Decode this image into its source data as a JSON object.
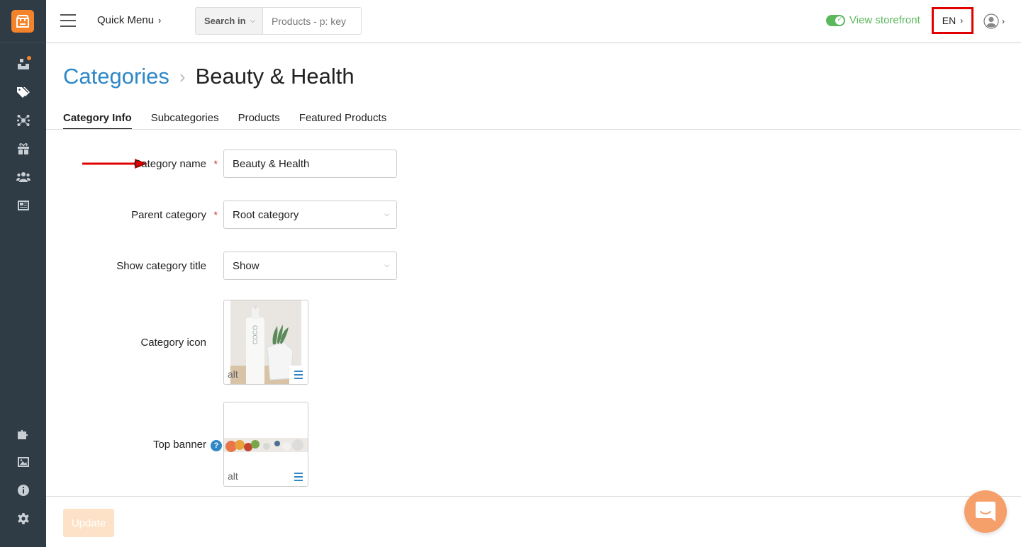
{
  "sidebar": {
    "items": [
      {
        "name": "orders-icon"
      },
      {
        "name": "tags-icon"
      },
      {
        "name": "network-icon"
      },
      {
        "name": "gift-icon"
      },
      {
        "name": "users-icon"
      },
      {
        "name": "news-icon"
      },
      {
        "name": "puzzle-icon"
      },
      {
        "name": "image-icon"
      },
      {
        "name": "info-icon"
      },
      {
        "name": "gear-icon"
      }
    ]
  },
  "topbar": {
    "quick_menu": "Quick Menu",
    "search_in": "Search in",
    "search_placeholder": "Products - p: key",
    "view_storefront": "View storefront",
    "lang": "EN"
  },
  "breadcrumb": {
    "parent": "Categories",
    "current": "Beauty & Health"
  },
  "tabs": [
    "Category Info",
    "Subcategories",
    "Products",
    "Featured Products"
  ],
  "form": {
    "category_name_label": "Category name",
    "category_name_value": "Beauty & Health",
    "parent_category_label": "Parent category",
    "parent_category_value": "Root category",
    "show_title_label": "Show category title",
    "show_title_value": "Show",
    "icon_label": "Category icon",
    "icon_alt": "alt",
    "banner_label": "Top banner",
    "banner_alt": "alt",
    "required_mark": "*",
    "help_mark": "?"
  },
  "footer": {
    "update_label": "Update"
  },
  "colors": {
    "accent": "#2f87c7",
    "brand": "#f5832a",
    "sidebar": "#2f3b45",
    "success": "#5cb85c",
    "highlight": "#e00000"
  }
}
